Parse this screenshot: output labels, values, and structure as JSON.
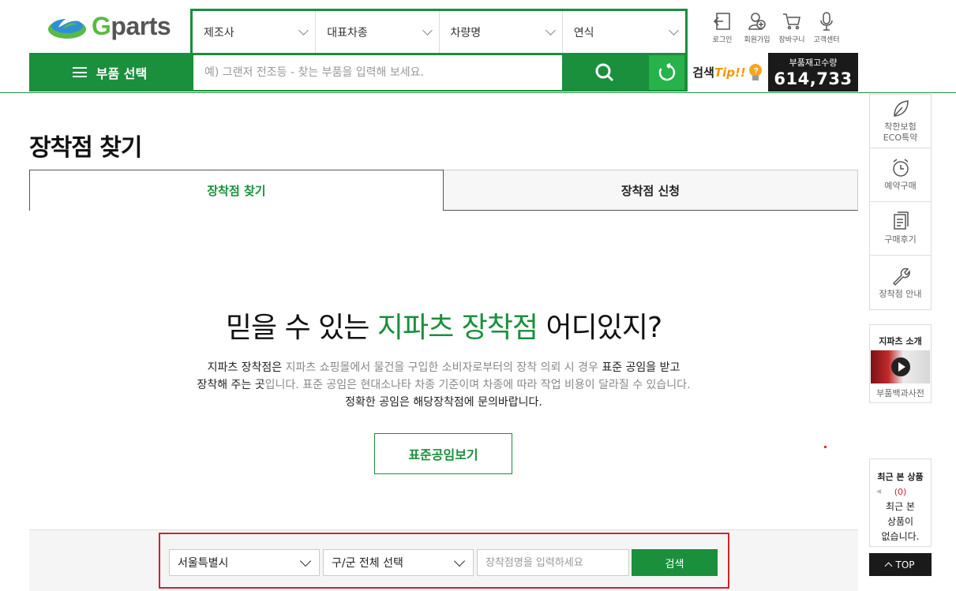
{
  "brand": {
    "logo_text_g": "G",
    "logo_text_rest": "parts"
  },
  "filters": [
    {
      "label": "제조사"
    },
    {
      "label": "대표차종"
    },
    {
      "label": "차량명"
    },
    {
      "label": "연식"
    }
  ],
  "top_nav": [
    {
      "label": "로그인",
      "icon": "login-icon"
    },
    {
      "label": "회원가입",
      "icon": "join-icon"
    },
    {
      "label": "장바구니",
      "icon": "cart-icon"
    },
    {
      "label": "고객센터",
      "icon": "mic-icon"
    }
  ],
  "menu": {
    "label": "부품 선택"
  },
  "search": {
    "placeholder": "예) 그랜저 전조등 - 찾는 부품을 입력해 보세요."
  },
  "tip": {
    "prefix": "검색",
    "tip": "Tip!!"
  },
  "stock": {
    "label": "부품재고수량",
    "value": "614,733"
  },
  "page": {
    "title": "장착점 찾기"
  },
  "tabs": [
    {
      "label": "장착점 찾기",
      "active": true
    },
    {
      "label": "장착점 신청",
      "active": false
    }
  ],
  "hero": {
    "headline_pre": "믿을 수 있는 ",
    "headline_highlight": "지파츠 장착점",
    "headline_post": " 어디있지?",
    "line1_a": "지파츠 장착점은 ",
    "line1_b": "지파츠 쇼핑몰에서 물건을 구입한 소비자로부터의 장착 의뢰 시 경우",
    "line1_c": " 표준 공임을 받고",
    "line2_a": "장착해 주는 곳",
    "line2_b": "입니다. 표준 공임은 현대소나타 차종 기준이며 차종에 따라 작업 비용이 달라질 수 있습니다.",
    "line3": "정확한 공임은 해당장착점에 문의바랍니다.",
    "button": "표준공임보기"
  },
  "store_search": {
    "city": "서울특별시",
    "district": "구/군 전체 선택",
    "name_placeholder": "장착점명을 입력하세요",
    "button": "검색"
  },
  "sidebar": {
    "items": [
      {
        "label1": "착한보험",
        "label2": "ECO특약",
        "icon": "leaf-icon"
      },
      {
        "label1": "예약구매",
        "label2": "",
        "icon": "clock-icon"
      },
      {
        "label1": "구매후기",
        "label2": "",
        "icon": "document-icon"
      },
      {
        "label1": "장착점 안내",
        "label2": "",
        "icon": "wrench-icon"
      }
    ],
    "intro_title": "지파츠 소개",
    "intro_sub": "부품백과사전",
    "recent_title": "최근 본 상품",
    "recent_count": "(0)",
    "recent_msg1": "최근 본",
    "recent_msg2": "상품이",
    "recent_msg3": "없습니다.",
    "top": "TOP"
  },
  "colors": {
    "brand_green": "#1a8f3c",
    "accent_red": "#d0242b",
    "tip_orange": "#f39800"
  }
}
